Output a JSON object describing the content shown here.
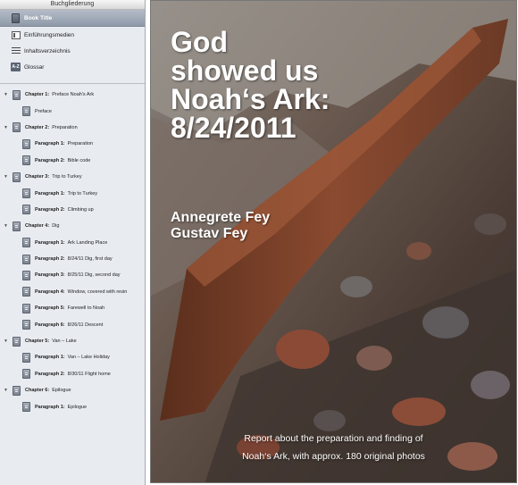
{
  "sidebar": {
    "header": "Buchgliederung",
    "selected": "Book Title",
    "items": [
      {
        "icon": "media-icon",
        "label": "Einführungsmedien"
      },
      {
        "icon": "list-icon",
        "label": "Inhaltsverzeichnis"
      },
      {
        "icon": "az-icon",
        "label": "Glossar",
        "glyph": "A-Z"
      }
    ],
    "tree": [
      {
        "kind": "chapter",
        "num": "Chapter 1:",
        "label": "Preface Noah's Ark"
      },
      {
        "kind": "para",
        "num": "",
        "label": "Preface"
      },
      {
        "kind": "chapter",
        "num": "Chapter 2:",
        "label": "Preparation"
      },
      {
        "kind": "para",
        "num": "Paragraph 1:",
        "label": "Preparation"
      },
      {
        "kind": "para",
        "num": "Paragraph 2:",
        "label": "Bible code"
      },
      {
        "kind": "chapter",
        "num": "Chapter 3:",
        "label": "Trip to Turkey"
      },
      {
        "kind": "para",
        "num": "Paragraph 1:",
        "label": "Trip to Turkey"
      },
      {
        "kind": "para",
        "num": "Paragraph 2:",
        "label": "Climbing up"
      },
      {
        "kind": "chapter",
        "num": "Chapter 4:",
        "label": "Dig"
      },
      {
        "kind": "para",
        "num": "Paragraph 1:",
        "label": "Ark Landing Place"
      },
      {
        "kind": "para",
        "num": "Paragraph 2:",
        "label": "8/24/11 Dig, first day"
      },
      {
        "kind": "para",
        "num": "Paragraph 3:",
        "label": "8/25/11 Dig, second day"
      },
      {
        "kind": "para",
        "num": "Paragraph 4:",
        "label": "Window, covered with resin"
      },
      {
        "kind": "para",
        "num": "Paragraph 5:",
        "label": "Farewell to Noah"
      },
      {
        "kind": "para",
        "num": "Paragraph 6:",
        "label": "8/26/11 Descent"
      },
      {
        "kind": "chapter",
        "num": "Chapter 5:",
        "label": "Van – Lake"
      },
      {
        "kind": "para",
        "num": "Paragraph 1:",
        "label": "Van – Lake Holiday"
      },
      {
        "kind": "para",
        "num": "Paragraph 2:",
        "label": "8/30/11 Flight home"
      },
      {
        "kind": "chapter",
        "num": "Chapter 6:",
        "label": "Epilogue"
      },
      {
        "kind": "para",
        "num": "Paragraph 1:",
        "label": "Epilogue"
      }
    ]
  },
  "cover": {
    "title": "God\nshowed us\nNoah‘s Ark:\n8/24/2011",
    "authors": [
      "Annegrete Fey",
      "Gustav Fey"
    ],
    "subtitle_line1": "Report about the preparation and finding of",
    "subtitle_line2": "Noah‘s Ark, with approx. 180 original photos"
  }
}
